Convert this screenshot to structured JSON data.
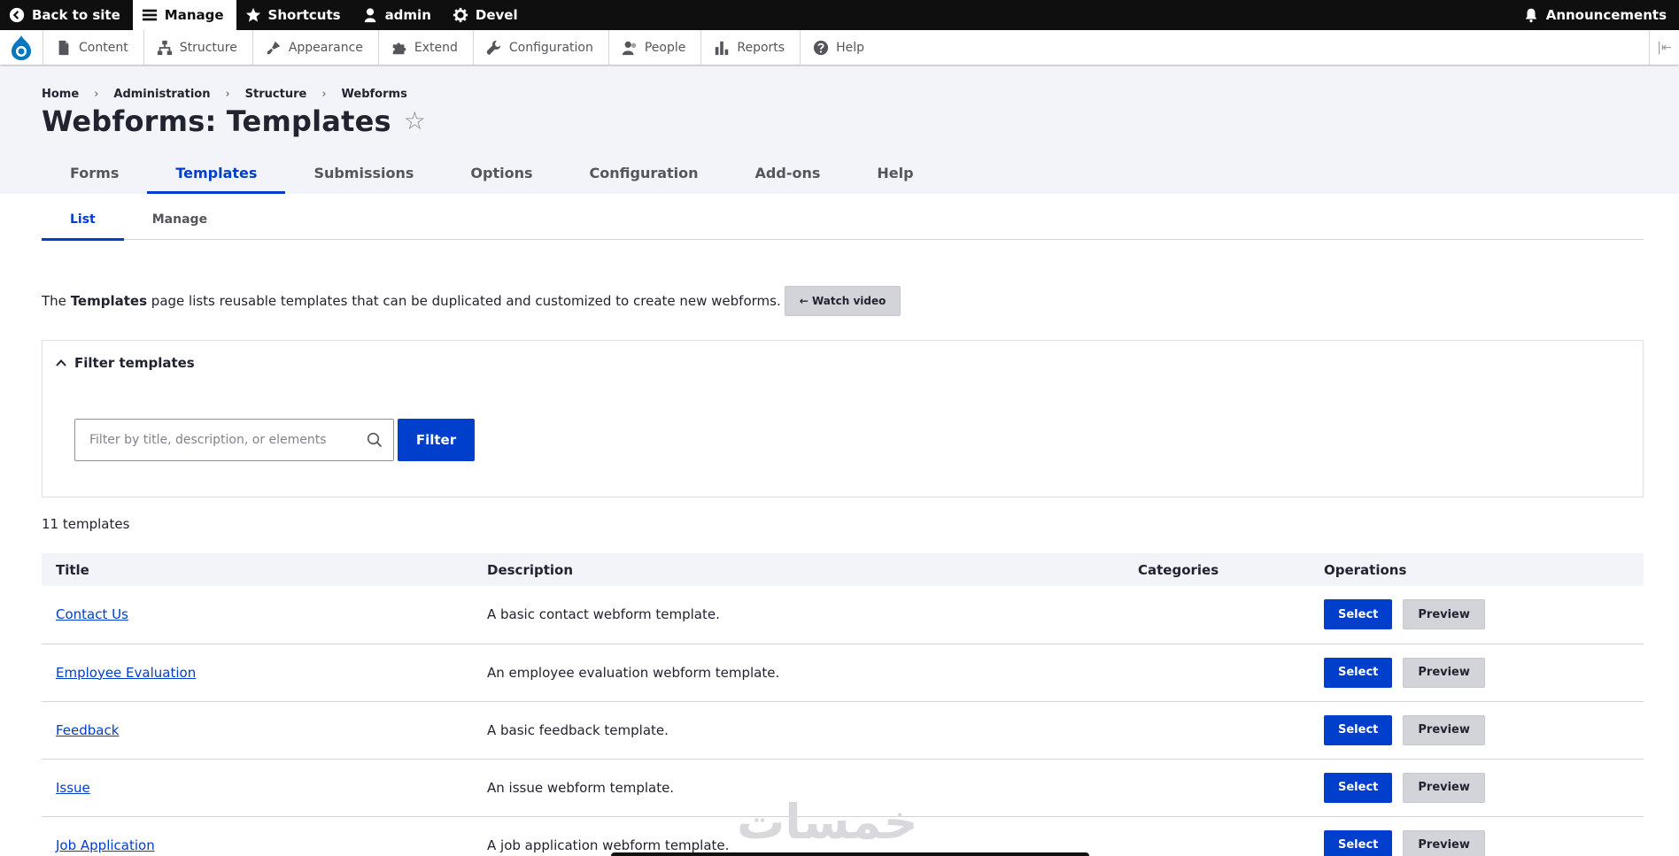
{
  "toolbar": {
    "back_label": "Back to site",
    "manage_label": "Manage",
    "shortcuts_label": "Shortcuts",
    "user_label": "admin",
    "devel_label": "Devel",
    "announcements_label": "Announcements"
  },
  "tray": {
    "items": [
      {
        "label": "Content",
        "icon": "file-icon"
      },
      {
        "label": "Structure",
        "icon": "structure-icon"
      },
      {
        "label": "Appearance",
        "icon": "paintbrush-icon"
      },
      {
        "label": "Extend",
        "icon": "puzzle-icon"
      },
      {
        "label": "Configuration",
        "icon": "wrench-icon"
      },
      {
        "label": "People",
        "icon": "people-icon"
      },
      {
        "label": "Reports",
        "icon": "bar-chart-icon"
      },
      {
        "label": "Help",
        "icon": "help-icon"
      }
    ]
  },
  "breadcrumb": [
    "Home",
    "Administration",
    "Structure",
    "Webforms"
  ],
  "page": {
    "title": "Webforms: Templates"
  },
  "primary_tabs": [
    "Forms",
    "Templates",
    "Submissions",
    "Options",
    "Configuration",
    "Add-ons",
    "Help"
  ],
  "secondary_tabs": [
    "List",
    "Manage"
  ],
  "intro": {
    "prefix": "The",
    "bold": "Templates",
    "suffix": "page lists reusable templates that can be duplicated and customized to create new webforms.",
    "watch_label": "← Watch video"
  },
  "filter": {
    "summary": "Filter templates",
    "placeholder": "Filter by title, description, or elements",
    "value": "",
    "button_label": "Filter"
  },
  "count_label": "11 templates",
  "table": {
    "headers": [
      "Title",
      "Description",
      "Categories",
      "Operations"
    ],
    "select_label": "Select",
    "preview_label": "Preview",
    "rows": [
      {
        "title": "Contact Us",
        "description": "A basic contact webform template.",
        "categories": ""
      },
      {
        "title": "Employee Evaluation",
        "description": "An employee evaluation webform template.",
        "categories": ""
      },
      {
        "title": "Feedback",
        "description": "A basic feedback template.",
        "categories": ""
      },
      {
        "title": "Issue",
        "description": "An issue webform template.",
        "categories": ""
      },
      {
        "title": "Job Application",
        "description": "A job application webform template.",
        "categories": ""
      }
    ]
  },
  "colors": {
    "accent": "#003ecc",
    "toolbar_bg": "#0f0f0f",
    "header_bg": "#f3f4f9"
  },
  "watermark": "خمسات"
}
